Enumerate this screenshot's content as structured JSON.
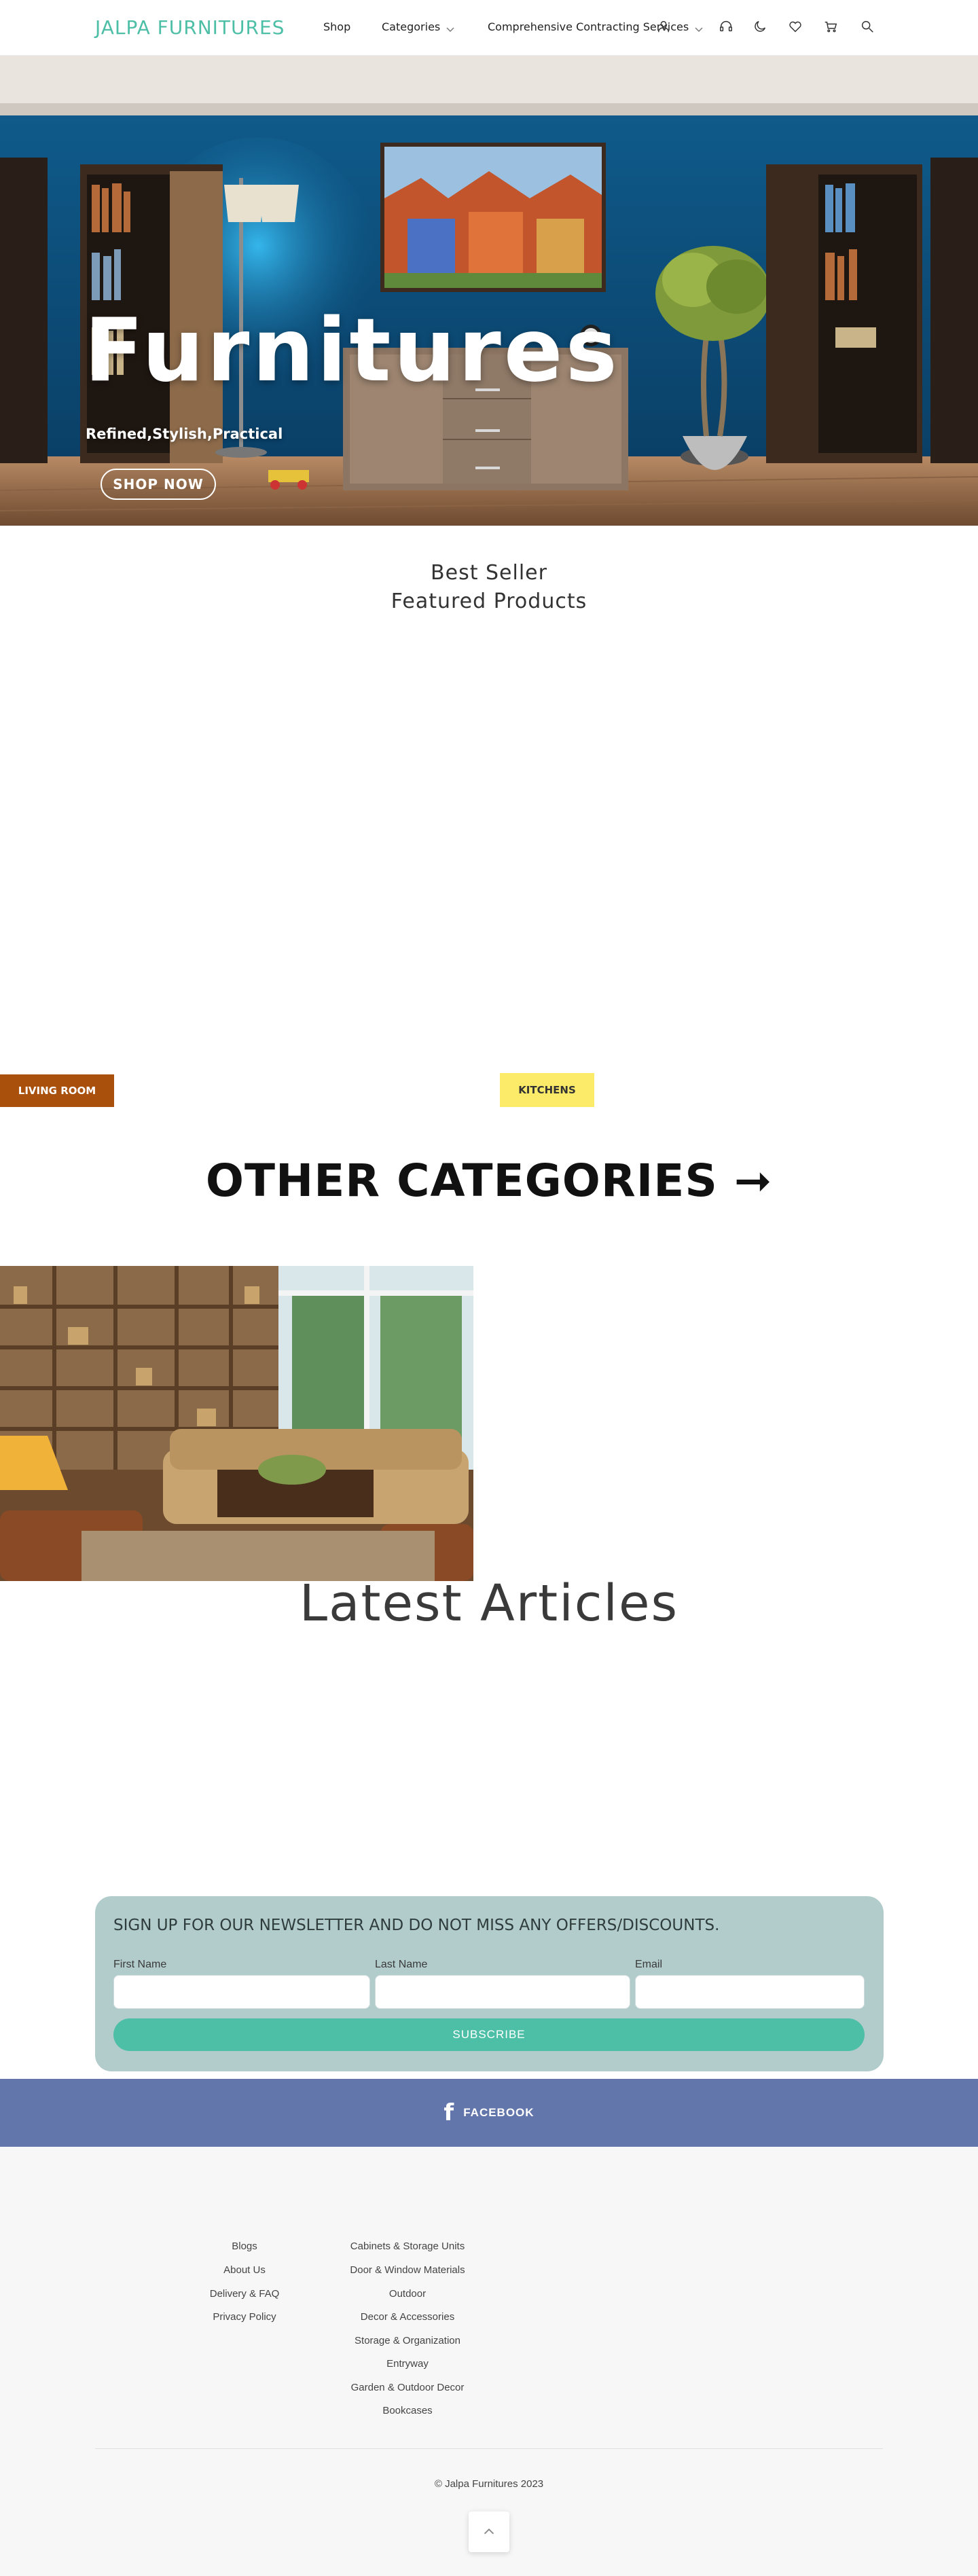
{
  "header": {
    "logo": "JALPA FURNITURES",
    "nav": {
      "shop": "Shop",
      "categories": "Categories",
      "contracting": "Comprehensive Contracting Services"
    },
    "icons": [
      "user-icon",
      "headset-icon",
      "moon-icon",
      "heart-icon",
      "cart-icon",
      "search-icon"
    ]
  },
  "hero": {
    "title": "Furnitures",
    "subtitle": "Refined,Stylish,Practical",
    "button": "SHOP NOW"
  },
  "featured": {
    "eyebrow": "Best Seller",
    "title": "Featured Products"
  },
  "categories": {
    "living_room": "LIVING ROOM",
    "kitchens": "KITCHENS",
    "other_heading": "OTHER CATEGORIES ➞"
  },
  "articles": {
    "title": "Latest Articles"
  },
  "newsletter": {
    "title": "SIGN UP FOR OUR NEWSLETTER AND DO NOT MISS ANY OFFERS/DISCOUNTS.",
    "first_name_label": "First Name",
    "last_name_label": "Last Name",
    "email_label": "Email",
    "first_name_value": "",
    "last_name_value": "",
    "email_value": "",
    "submit": "SUBSCRIBE"
  },
  "social": {
    "facebook_label": "FACEBOOK",
    "facebook_glyph": "f"
  },
  "footer": {
    "col1": [
      "Blogs",
      "About Us",
      "Delivery & FAQ",
      "Privacy Policy"
    ],
    "col2": [
      "Cabinets & Storage Units",
      "Door & Window Materials",
      "Outdoor",
      "Decor & Accessories",
      "Storage & Organization",
      "Entryway",
      "Garden & Outdoor Decor",
      "Bookcases"
    ],
    "copyright": "© Jalpa Furnitures 2023"
  },
  "colors": {
    "brand": "#4dbfa6",
    "living_room_tag": "#a8500c",
    "kitchens_tag": "#fbeb69",
    "newsletter_bg": "#b2cbcb",
    "facebook_band": "#6276ab"
  }
}
